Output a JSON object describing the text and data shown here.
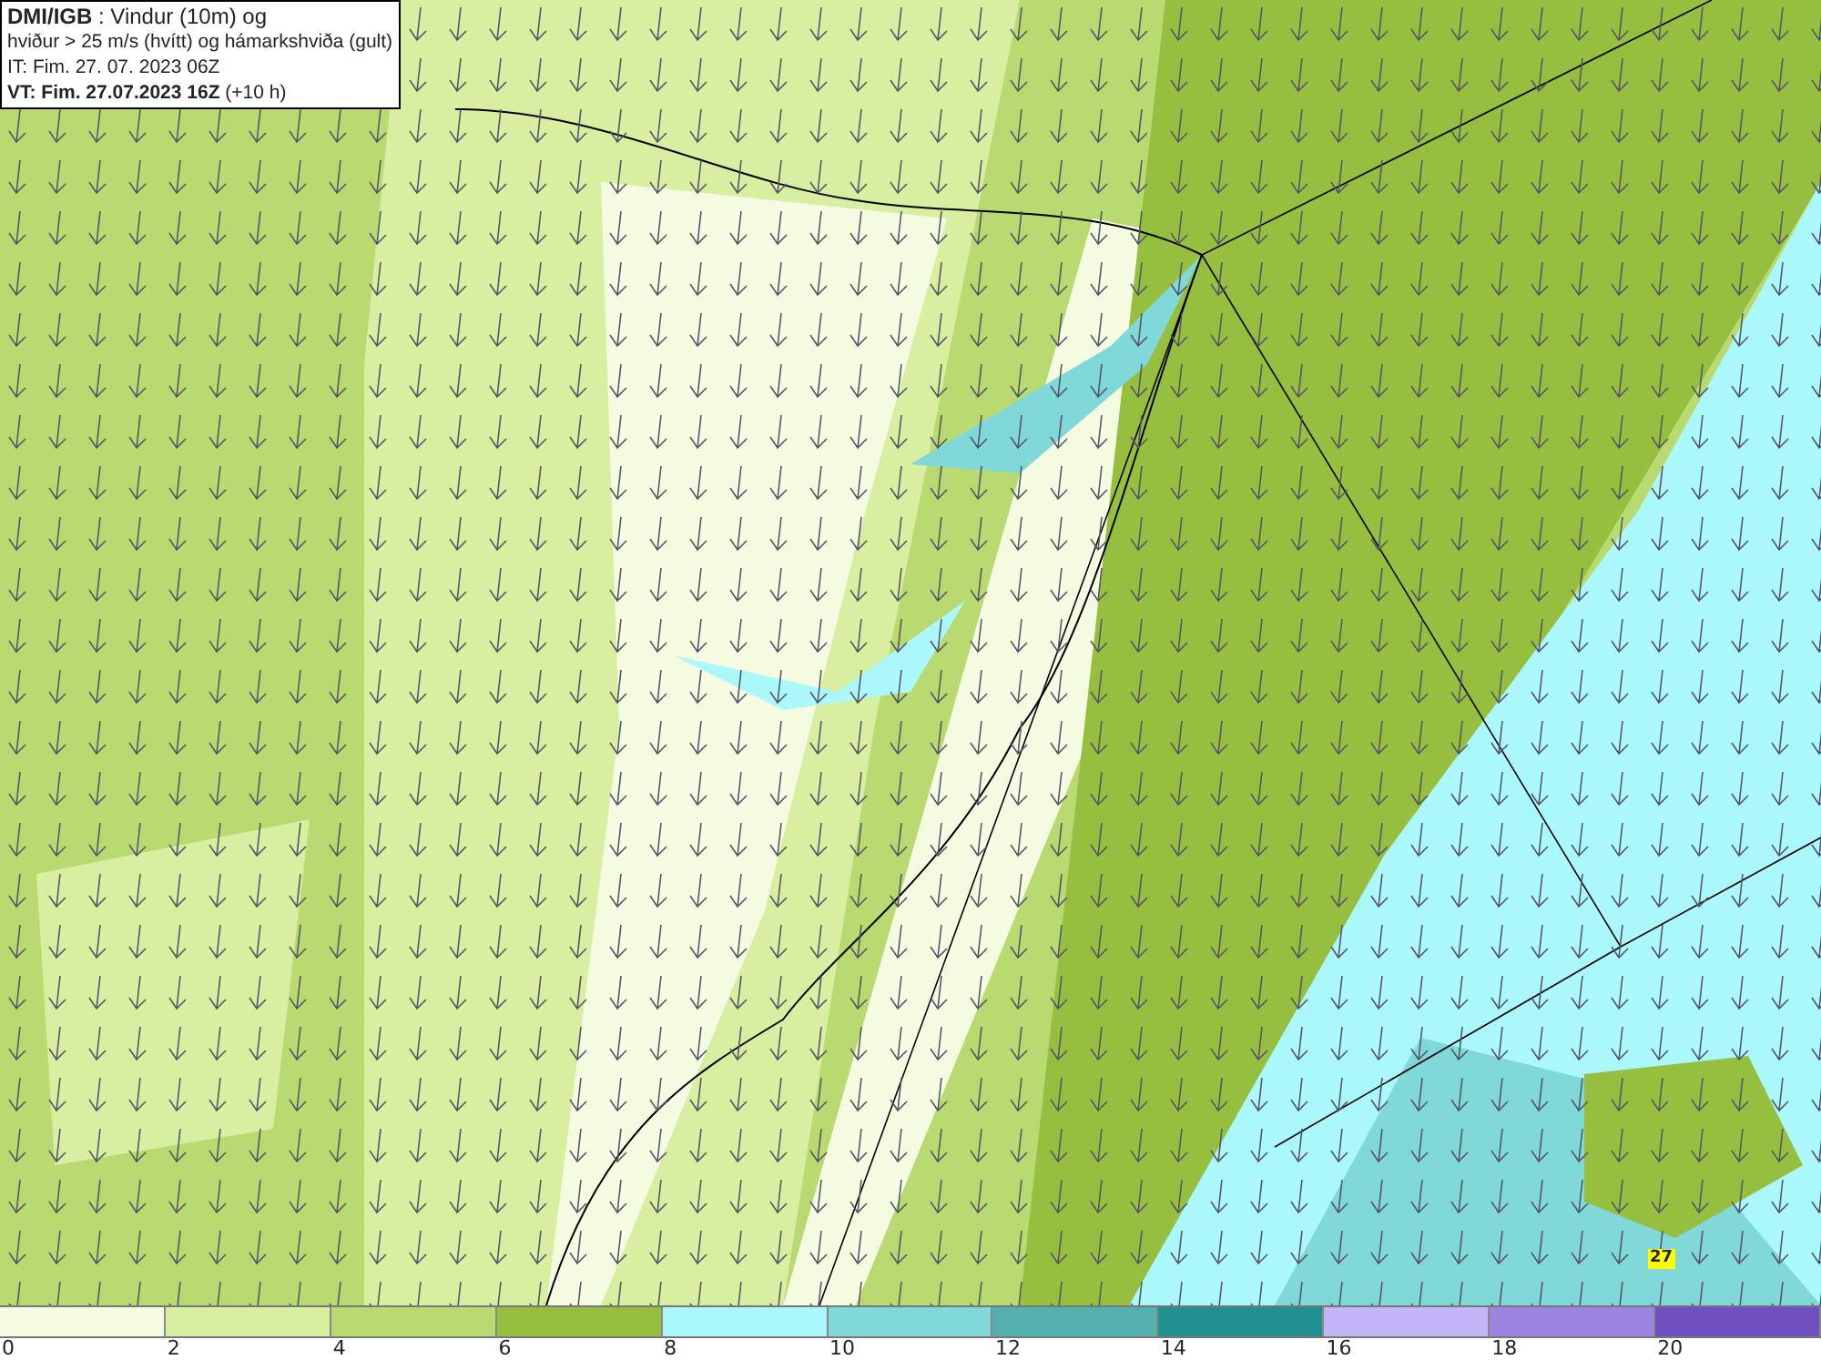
{
  "title_box": {
    "lines": [
      "**DMI/IGB** : Vindur (10m) og",
      "hviður > 25 m/s (hvítt) og hámarkshviða (gult)",
      "IT: Fim. 27. 07. 2023 06Z",
      "**VT: Fim. 27.07.2023 16Z** (+10 h)"
    ]
  },
  "map": {
    "max_gust_label": "27"
  },
  "legend": {
    "segments": [
      {
        "color": "#f5fbe0"
      },
      {
        "color": "#d8eea0"
      },
      {
        "color": "#b8da70"
      },
      {
        "color": "#96bf40"
      },
      {
        "color": "#aaf8fc"
      },
      {
        "color": "#80d8d8"
      },
      {
        "color": "#55b0b0"
      },
      {
        "color": "#219090"
      },
      {
        "color": "#c4b4f8"
      },
      {
        "color": "#9c84e0"
      },
      {
        "color": "#7050c0"
      }
    ],
    "ticks": [
      "0",
      "2",
      "4",
      "6",
      "8",
      "10",
      "12",
      "14",
      "16",
      "18",
      "20"
    ]
  }
}
